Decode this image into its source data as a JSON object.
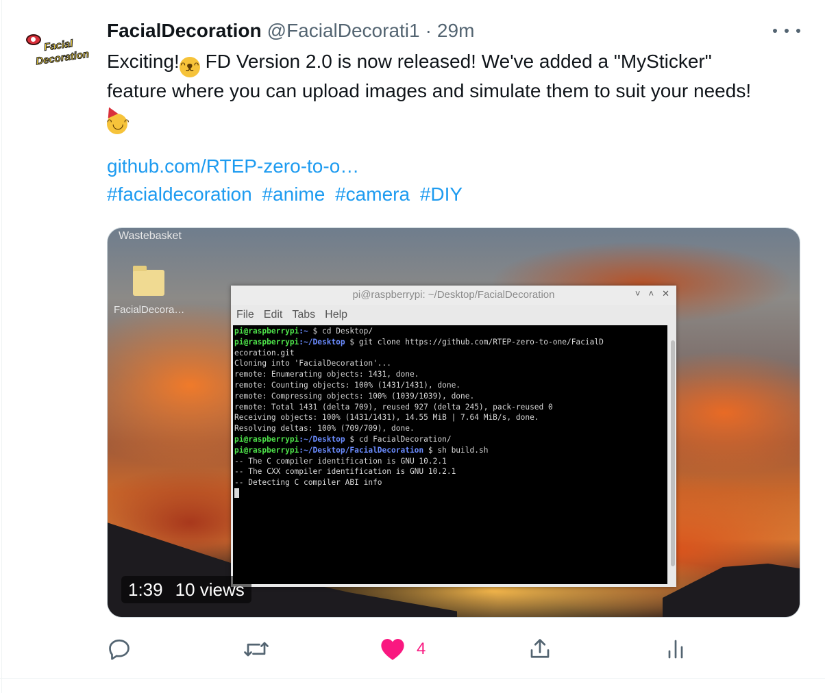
{
  "tweet": {
    "author_name": "FacialDecoration",
    "handle": "@FacialDecorati1",
    "separator": "·",
    "time": "29m",
    "avatar": {
      "line1": "Facial",
      "line2": "Decoration"
    },
    "text_line1_a": "Exciting!",
    "text_line1_b": " FD Version 2.0 is now released! We've added a \"MySticker\"",
    "text_line2": "feature where you can upload images and simulate them to suit your needs!",
    "emoji_1": "laughing-face",
    "emoji_2": "partying-face",
    "link": "github.com/RTEP-zero-to-o…",
    "hashtags": [
      "#facialdecoration",
      "#anime",
      "#camera",
      "#DIY"
    ]
  },
  "media": {
    "desktop_wastebasket": "Wastebasket",
    "desktop_folder": "FacialDecora…",
    "window_title": "pi@raspberrypi: ~/Desktop/FacialDecoration",
    "window_buttons": [
      "˅",
      "˄",
      "✕"
    ],
    "menu": [
      "File",
      "Edit",
      "Tabs",
      "Help"
    ],
    "terminal": {
      "prompt_user": "pi@raspberrypi",
      "path_home": ":~ ",
      "cmd1": "$ cd Desktop/",
      "path_desktop": ":~/Desktop ",
      "cmd2": "$ git clone https://github.com/RTEP-zero-to-one/FacialD",
      "out1": "ecoration.git",
      "out2": "Cloning into 'FacialDecoration'...",
      "out3": "remote: Enumerating objects: 1431, done.",
      "out4": "remote: Counting objects: 100% (1431/1431), done.",
      "out5": "remote: Compressing objects: 100% (1039/1039), done.",
      "out6": "remote: Total 1431 (delta 709), reused 927 (delta 245), pack-reused 0",
      "out7": "Receiving objects: 100% (1431/1431), 14.55 MiB | 7.64 MiB/s, done.",
      "out8": "Resolving deltas: 100% (709/709), done.",
      "cmd3": "$ cd FacialDecoration/",
      "path_fd": ":~/Desktop/FacialDecoration ",
      "cmd4": "$ sh build.sh",
      "out9": "-- The C compiler identification is GNU 10.2.1",
      "out10": "-- The CXX compiler identification is GNU 10.2.1",
      "out11": "-- Detecting C compiler ABI info"
    },
    "duration": "1:39",
    "views": "10 views"
  },
  "actions": {
    "reply_icon": "reply-icon",
    "retweet_icon": "retweet-icon",
    "like_icon": "heart-filled-icon",
    "like_count": "4",
    "share_icon": "share-icon",
    "analytics_icon": "analytics-icon",
    "like_color": "#f91880",
    "icon_color": "#536471"
  },
  "colors": {
    "link": "#1d9bf0",
    "text": "#0f1419",
    "muted": "#536471"
  }
}
